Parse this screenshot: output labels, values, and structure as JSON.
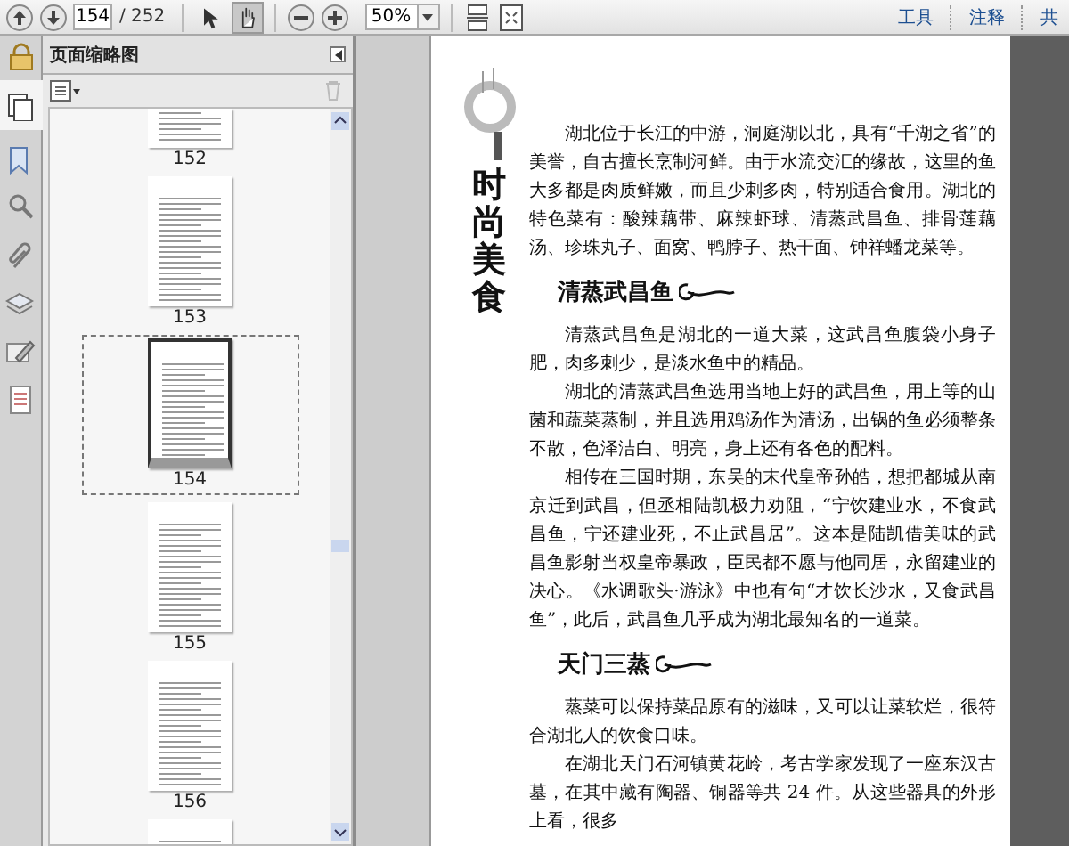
{
  "toolbar": {
    "nav_buttons": [
      {
        "kind": "up"
      },
      {
        "kind": "down"
      }
    ],
    "page_field": {
      "value": "154"
    },
    "page_total": "/ 252",
    "tools": [
      {
        "kind": "select",
        "selected": false
      },
      {
        "kind": "hand",
        "selected": true
      }
    ],
    "zoom_buttons": [
      {
        "kind": "minus"
      },
      {
        "kind": "plus"
      }
    ],
    "zoom_field": {
      "value": "50%"
    },
    "view_buttons": [
      {
        "kind": "scroll"
      },
      {
        "kind": "fit"
      }
    ],
    "menu": [
      "工具",
      "注释",
      "共"
    ]
  },
  "sidebar": {
    "icons": [
      {
        "kind": "pages",
        "selected": true
      },
      {
        "kind": "bookmark",
        "selected": false
      },
      {
        "kind": "signature-search",
        "selected": false
      },
      {
        "kind": "attachment",
        "selected": false
      },
      {
        "kind": "layers",
        "selected": false
      },
      {
        "kind": "sign",
        "selected": false
      },
      {
        "kind": "document",
        "selected": false
      }
    ],
    "title": "页面缩略图",
    "thumbnails": [
      {
        "label": "152",
        "kind": "tail",
        "selected": false
      },
      {
        "label": "153",
        "kind": "full",
        "selected": false
      },
      {
        "label": "154",
        "kind": "full",
        "selected": true
      },
      {
        "label": "155",
        "kind": "full",
        "selected": false
      },
      {
        "label": "156",
        "kind": "full",
        "selected": false
      },
      {
        "kind": "head",
        "selected": false
      }
    ]
  },
  "document": {
    "side_title": "时尚美食",
    "blocks": [
      {
        "kind": "paragraph",
        "text": "湖北位于长江的中游，洞庭湖以北，具有“千湖之省”的美誉，自古擅长烹制河鲜。由于水流交汇的缘故，这里的鱼大多都是肉质鲜嫩，而且少刺多肉，特别适合食用。湖北的特色菜有：酸辣藕带、麻辣虾球、清蒸武昌鱼、排骨莲藕汤、珍珠丸子、面窝、鸭脖子、热干面、钟祥蟠龙菜等。"
      },
      {
        "kind": "heading",
        "text": "清蒸武昌鱼"
      },
      {
        "kind": "paragraph",
        "text": "清蒸武昌鱼是湖北的一道大菜，这武昌鱼腹袋小身子肥，肉多刺少，是淡水鱼中的精品。"
      },
      {
        "kind": "paragraph",
        "text": "湖北的清蒸武昌鱼选用当地上好的武昌鱼，用上等的山菌和蔬菜蒸制，并且选用鸡汤作为清汤，出锅的鱼必须整条不散，色泽洁白、明亮，身上还有各色的配料。"
      },
      {
        "kind": "paragraph",
        "text": "相传在三国时期，东吴的末代皇帝孙皓，想把都城从南京迁到武昌，但丞相陆凯极力劝阻，“宁饮建业水，不食武昌鱼，宁还建业死，不止武昌居”。这本是陆凯借美味的武昌鱼影射当权皇帝暴政，臣民都不愿与他同居，永留建业的决心。《水调歌头·游泳》中也有句“才饮长沙水，又食武昌鱼”，此后，武昌鱼几乎成为湖北最知名的一道菜。"
      },
      {
        "kind": "heading",
        "text": "天门三蒸"
      },
      {
        "kind": "paragraph",
        "text": "蒸菜可以保持菜品原有的滋味，又可以让菜软烂，很符合湖北人的饮食口味。"
      },
      {
        "kind": "paragraph",
        "text": "在湖北天门石河镇黄花岭，考古学家发现了一座东汉古墓，在其中藏有陶器、铜器等共 24 件。从这些器具的外形上看，很多"
      }
    ]
  }
}
